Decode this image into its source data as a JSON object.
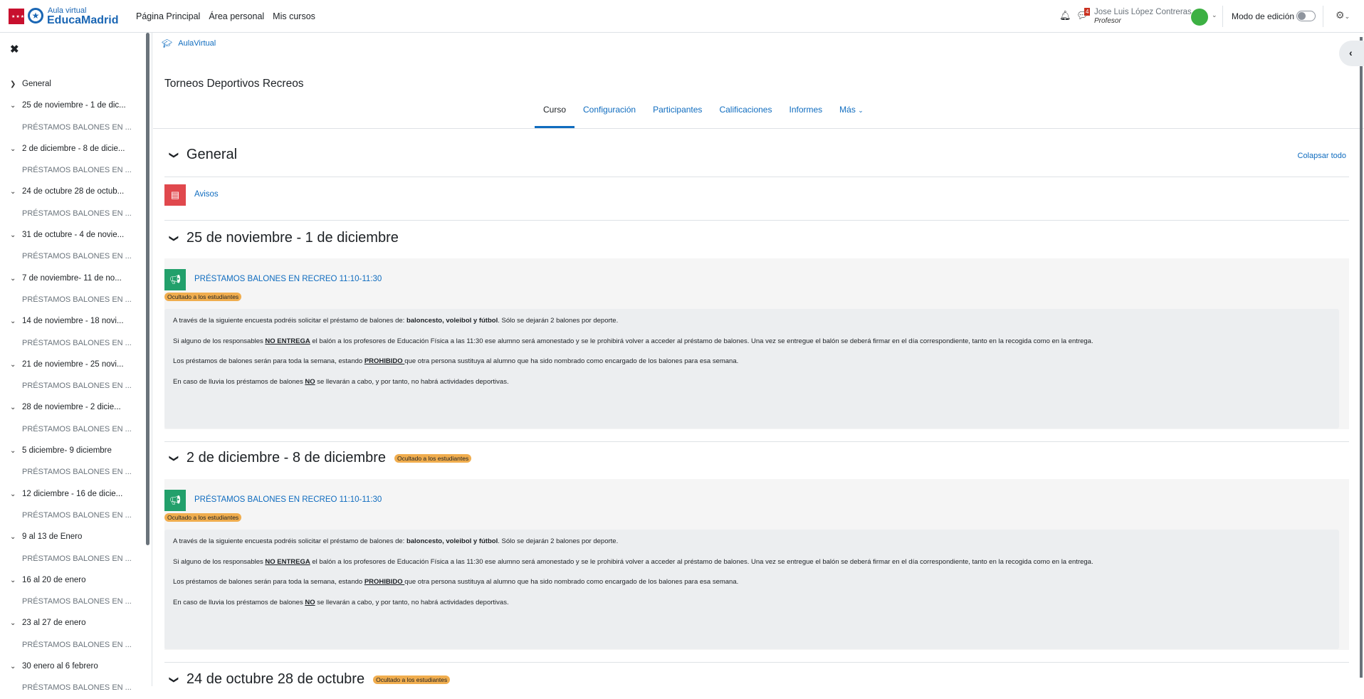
{
  "header": {
    "logo_top": "Aula virtual",
    "logo_main": "EducaMadrid",
    "logo_flag_text": "★★★★",
    "nav": [
      "Página Principal",
      "Área personal",
      "Mis cursos"
    ],
    "message_count": "4",
    "user_name": "Jose Luis López Contreras",
    "user_role": "Profesor",
    "edit_mode_label": "Modo de edición"
  },
  "sidebar": {
    "items": [
      {
        "type": "section",
        "label": "General",
        "expanded": false
      },
      {
        "type": "section",
        "label": "25 de noviembre - 1 de dic..."
      },
      {
        "type": "activity",
        "label": "PRÉSTAMOS BALONES EN ..."
      },
      {
        "type": "section",
        "label": "2 de diciembre - 8 de dicie..."
      },
      {
        "type": "activity",
        "label": "PRÉSTAMOS BALONES EN ..."
      },
      {
        "type": "section",
        "label": "24 de octubre 28 de octub..."
      },
      {
        "type": "activity",
        "label": "PRÉSTAMOS BALONES EN ..."
      },
      {
        "type": "section",
        "label": "31 de octubre - 4 de novie..."
      },
      {
        "type": "activity",
        "label": "PRÉSTAMOS BALONES EN ..."
      },
      {
        "type": "section",
        "label": "7 de noviembre- 11 de no..."
      },
      {
        "type": "activity",
        "label": "PRÉSTAMOS BALONES EN ..."
      },
      {
        "type": "section",
        "label": "14 de noviembre - 18 novi..."
      },
      {
        "type": "activity",
        "label": "PRÉSTAMOS BALONES EN ..."
      },
      {
        "type": "section",
        "label": "21 de noviembre - 25 novi..."
      },
      {
        "type": "activity",
        "label": "PRÉSTAMOS BALONES EN ..."
      },
      {
        "type": "section",
        "label": "28 de noviembre - 2 dicie..."
      },
      {
        "type": "activity",
        "label": "PRÉSTAMOS BALONES EN ..."
      },
      {
        "type": "section",
        "label": "5 diciembre- 9 diciembre"
      },
      {
        "type": "activity",
        "label": "PRÉSTAMOS BALONES EN ..."
      },
      {
        "type": "section",
        "label": "12 diciembre - 16 de dicie..."
      },
      {
        "type": "activity",
        "label": "PRÉSTAMOS BALONES EN ..."
      },
      {
        "type": "section",
        "label": "9 al 13 de Enero"
      },
      {
        "type": "activity",
        "label": "PRÉSTAMOS BALONES EN ..."
      },
      {
        "type": "section",
        "label": "16 al 20 de enero"
      },
      {
        "type": "activity",
        "label": "PRÉSTAMOS BALONES EN ..."
      },
      {
        "type": "section",
        "label": "23 al 27 de enero"
      },
      {
        "type": "activity",
        "label": "PRÉSTAMOS BALONES EN ..."
      },
      {
        "type": "section",
        "label": "30 enero al 6 febrero"
      },
      {
        "type": "activity",
        "label": "PRÉSTAMOS BALONES EN ..."
      }
    ]
  },
  "main": {
    "breadcrumb": "AulaVirtual",
    "course_title": "Torneos Deportivos Recreos",
    "tabs": [
      "Curso",
      "Configuración",
      "Participantes",
      "Calificaciones",
      "Informes",
      "Más"
    ],
    "collapse_all": "Colapsar todo",
    "general_title": "General",
    "avisos": "Avisos",
    "hidden_badge": "Ocultado a los estudiantes",
    "sections": [
      {
        "title": "25 de noviembre - 1 de diciembre"
      },
      {
        "title": "2 de diciembre - 8 de diciembre"
      },
      {
        "title": "24 de octubre 28 de octubre"
      }
    ],
    "activity_title": "PRÉSTAMOS BALONES EN RECREO 11:10-11:30",
    "desc": {
      "p1a": "A través de la siguiente encuesta podréis solicitar el préstamo de balones de: ",
      "p1b": "baloncesto, voleibol y fútbol",
      "p1c": ". Sólo se dejarán 2 balones por deporte.",
      "p2a": "Si alguno de los responsables ",
      "p2b": "NO ENTREGA",
      "p2c": " el balón a los profesores de Educación Física a las 11:30 ese alumno será amonestado y se le prohibirá volver a acceder al préstamo de balones. Una vez se entregue el balón se deberá firmar en el día correspondiente, tanto en la recogida como en la entrega.",
      "p3a": "Los préstamos de balones serán para toda la semana, estando ",
      "p3b": "PROHIBIDO ",
      "p3c": "que otra persona sustituya al alumno que ha sido nombrado como encargado de los balones para esa semana.",
      "p4a": "En caso de lluvia los préstamos de balones ",
      "p4b": "NO",
      "p4c": " se llevarán a cabo, y por tanto, no habrá actividades deportivas."
    }
  }
}
